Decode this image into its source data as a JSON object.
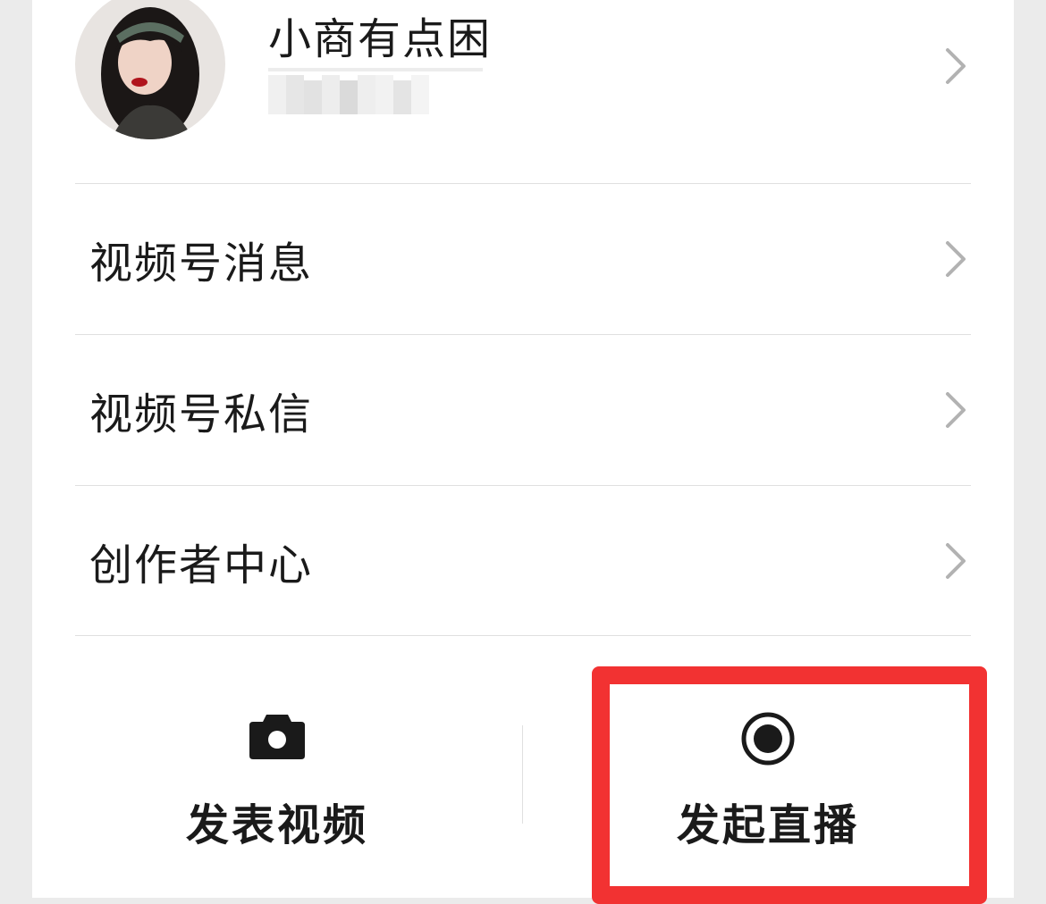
{
  "profile": {
    "username": "小商有点困",
    "id_obscured": true
  },
  "menu": {
    "items": [
      {
        "label": "视频号消息",
        "icon": "chevron-right-icon"
      },
      {
        "label": "视频号私信",
        "icon": "chevron-right-icon"
      },
      {
        "label": "创作者中心",
        "icon": "chevron-right-icon"
      }
    ]
  },
  "actions": {
    "post_video": {
      "label": "发表视频",
      "icon": "camera-icon"
    },
    "start_live": {
      "label": "发起直播",
      "icon": "live-record-icon",
      "highlighted": true
    }
  },
  "colors": {
    "highlight": "#f23232",
    "text": "#1a1a1a",
    "chevron": "#b2b2b2",
    "divider": "#e0e0e0"
  }
}
